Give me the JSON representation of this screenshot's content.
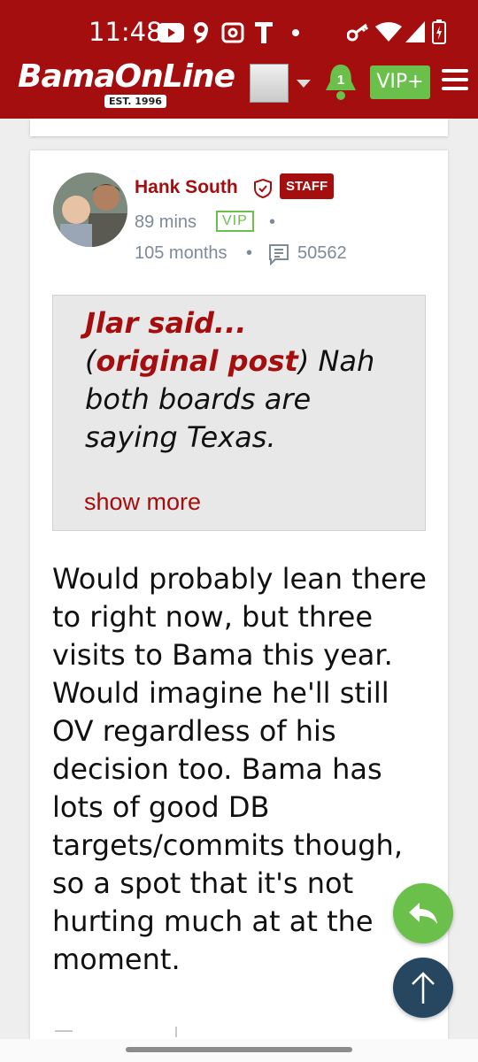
{
  "status_bar": {
    "time": "11:48",
    "left_icons": [
      "youtube-icon",
      "nine-icon",
      "radio-icon",
      "t-icon",
      "dot-icon"
    ],
    "right_icons": [
      "key-icon",
      "wifi-icon",
      "signal-icon",
      "battery-icon"
    ]
  },
  "header": {
    "logo_text": "BamaOnLine",
    "logo_est": "EST. 1996",
    "notification_count": "1",
    "vip_label": "VIP+",
    "colors": {
      "brand": "#a40e0e",
      "vip_green": "#6ac04a"
    }
  },
  "post": {
    "author": "Hank South",
    "role_badge": "STAFF",
    "time_ago": "89 mins",
    "membership_badge": "VIP",
    "tenure": "105 months",
    "post_count": "50562",
    "quote": {
      "author_said": "Jlar said...",
      "open_paren": " (",
      "original_link": "original post",
      "close_paren": ")",
      "text": " Nah both boards are saying Texas.",
      "show_more": "show more"
    },
    "body": "Would probably lean there to right now, but three visits to Bama this year. Would imagine he'll still OV regardless of his decision too. Bama has lots of good DB targets/commits though, so a spot that it's not hurting much at at the moment."
  },
  "fabs": {
    "reply_icon": "reply-arrow-icon",
    "top_icon": "arrow-up-icon"
  }
}
